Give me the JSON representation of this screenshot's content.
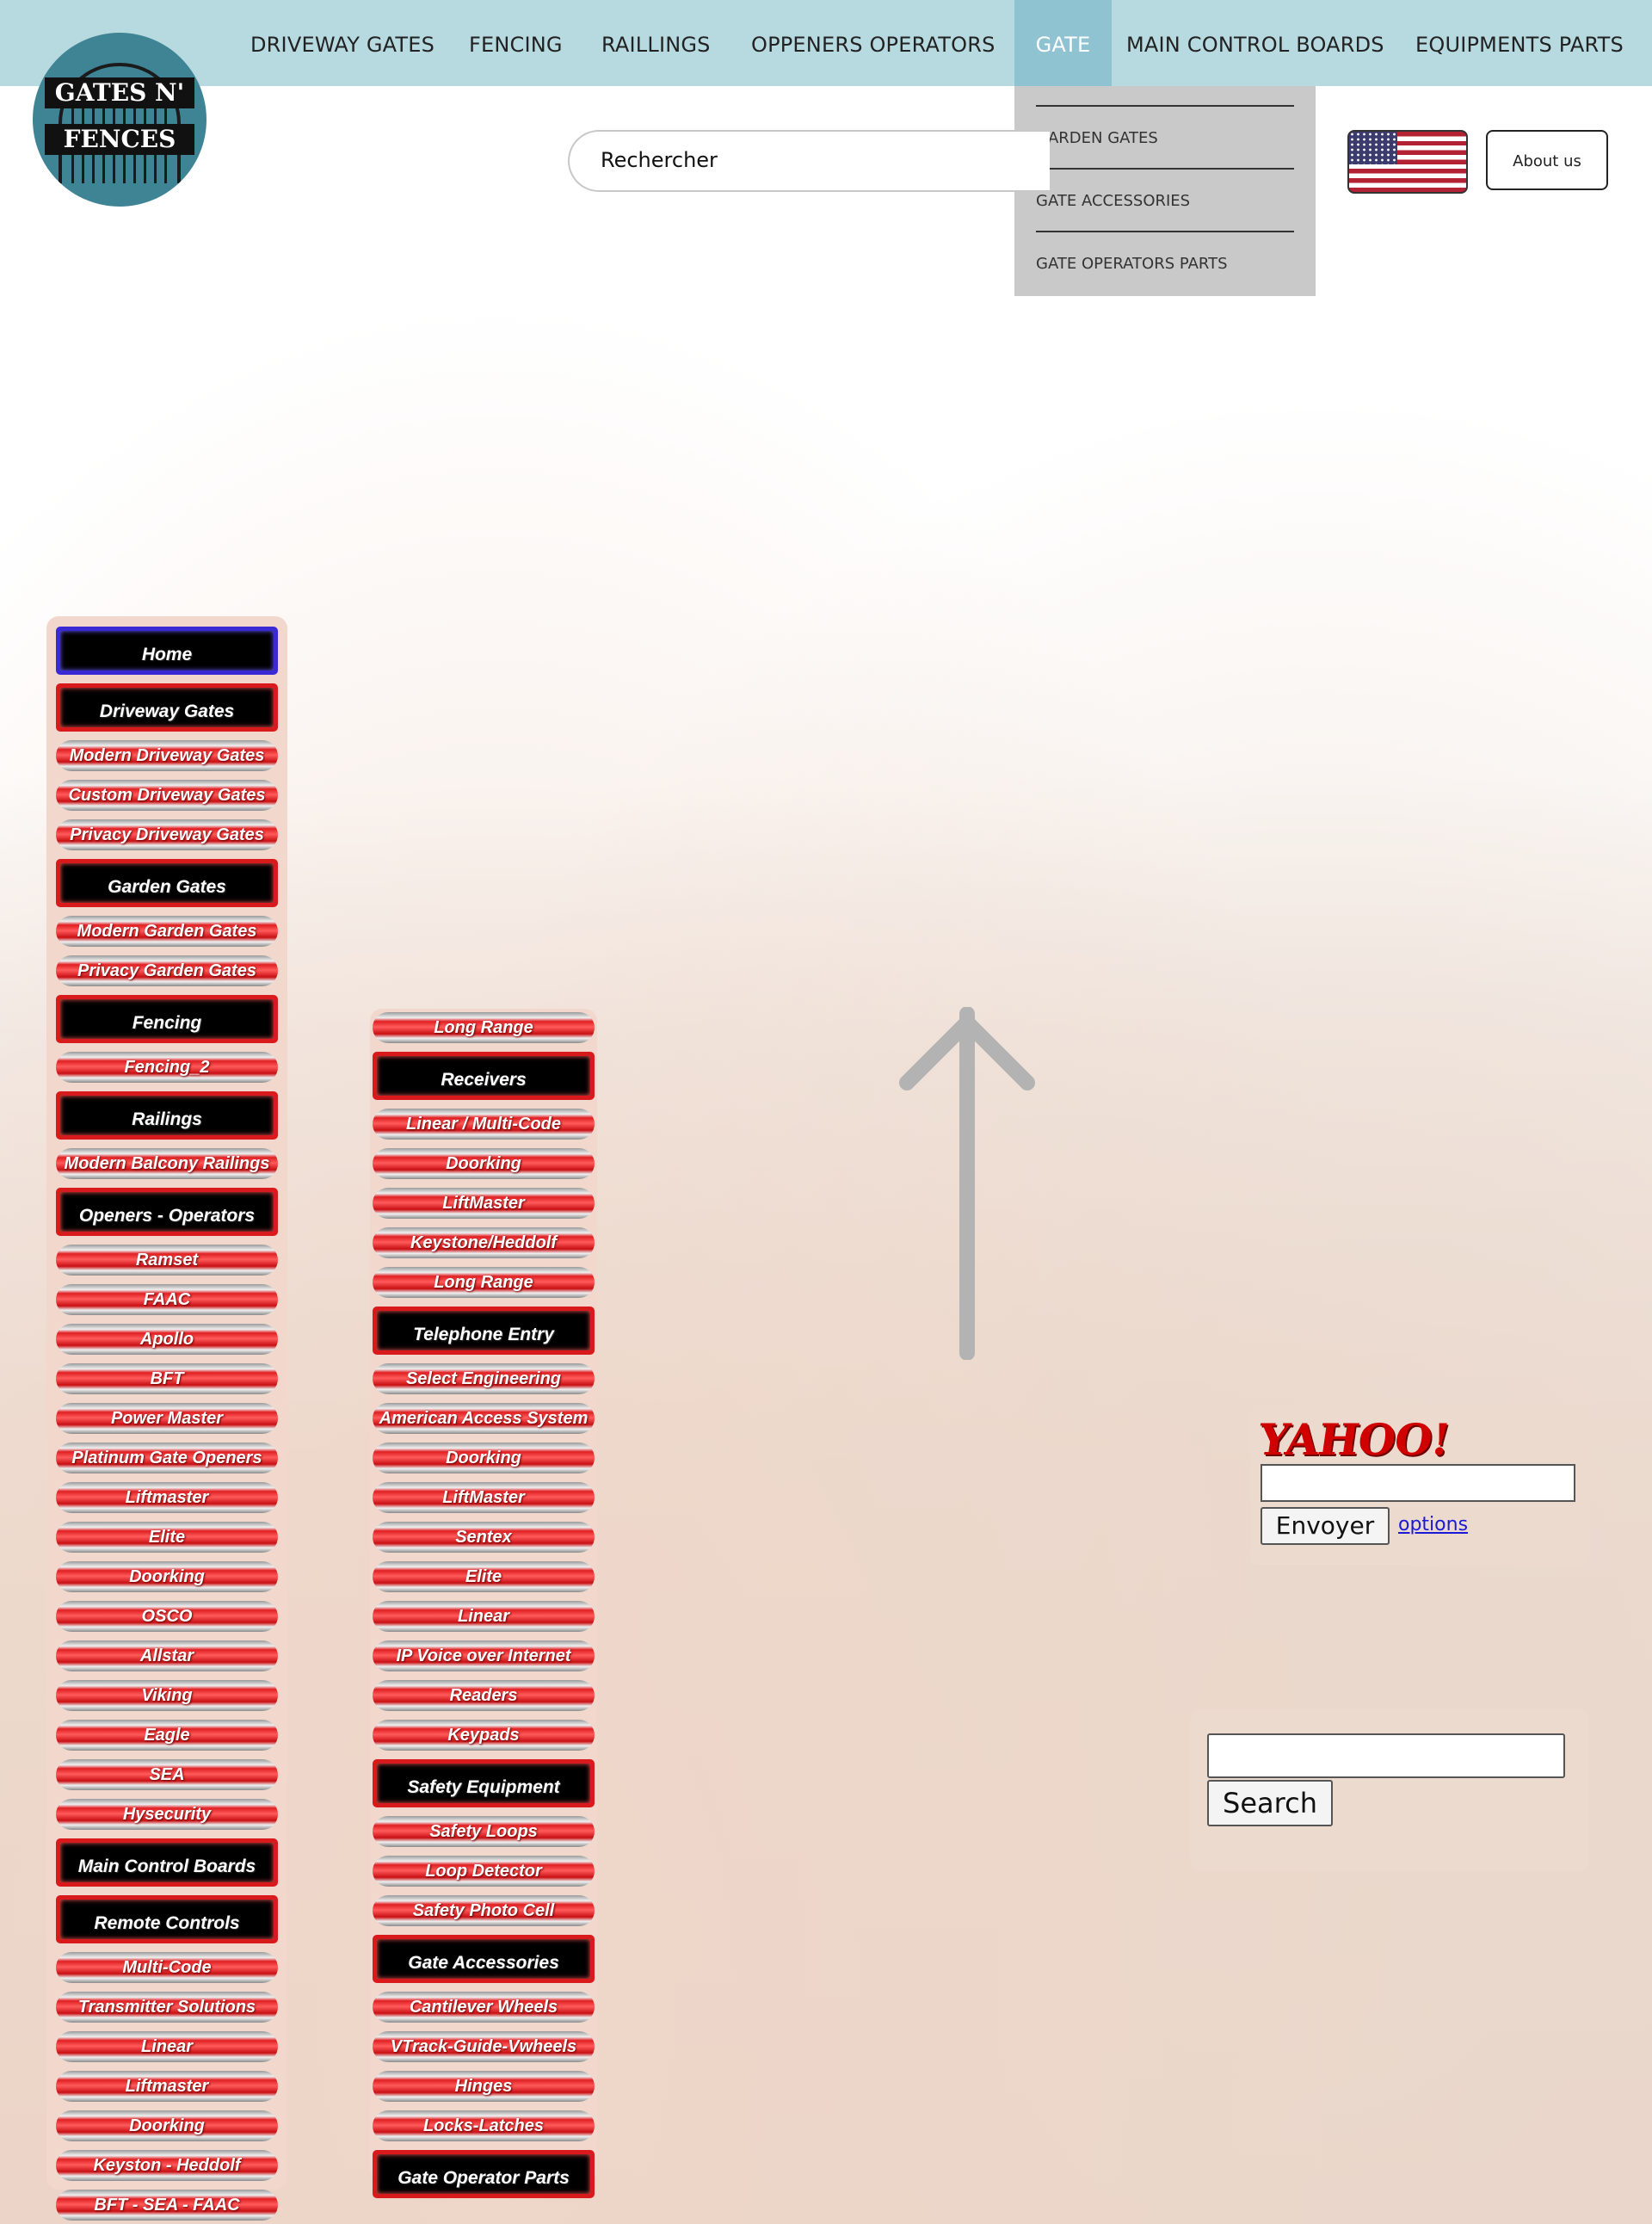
{
  "nav": {
    "items": [
      "DRIVEWAY GATES",
      "FENCING",
      "RAILLINGS",
      "OPPENERS OPERATORS",
      "GATE",
      "MAIN CONTROL BOARDS",
      "EQUIPMENTS PARTS"
    ],
    "active": "GATE",
    "dropdown": [
      "GARDEN GATES",
      "GATE ACCESSORIES",
      "GATE OPERATORS PARTS"
    ]
  },
  "logo": {
    "line1": "GATES N'",
    "line2": "FENCES"
  },
  "search": {
    "placeholder": "Rechercher"
  },
  "header": {
    "flag_icon": "us-flag-icon",
    "about_label": "About us"
  },
  "left_menu": [
    {
      "label": "Home",
      "type": "home"
    },
    {
      "label": "Driveway Gates",
      "type": "head"
    },
    {
      "label": "Modern Driveway Gates",
      "type": "sub"
    },
    {
      "label": "Custom Driveway Gates",
      "type": "sub"
    },
    {
      "label": "Privacy Driveway Gates",
      "type": "sub"
    },
    {
      "label": "Garden Gates",
      "type": "head"
    },
    {
      "label": "Modern Garden Gates",
      "type": "sub"
    },
    {
      "label": "Privacy Garden Gates",
      "type": "sub"
    },
    {
      "label": "Fencing",
      "type": "head"
    },
    {
      "label": "Fencing_2",
      "type": "sub"
    },
    {
      "label": "Railings",
      "type": "head"
    },
    {
      "label": "Modern Balcony Railings",
      "type": "sub"
    },
    {
      "label": "Openers - Operators",
      "type": "head"
    },
    {
      "label": "Ramset",
      "type": "sub"
    },
    {
      "label": "FAAC",
      "type": "sub"
    },
    {
      "label": "Apollo",
      "type": "sub"
    },
    {
      "label": "BFT",
      "type": "sub"
    },
    {
      "label": "Power Master",
      "type": "sub"
    },
    {
      "label": "Platinum Gate Openers",
      "type": "sub"
    },
    {
      "label": "Liftmaster",
      "type": "sub"
    },
    {
      "label": "Elite",
      "type": "sub"
    },
    {
      "label": "Doorking",
      "type": "sub"
    },
    {
      "label": "OSCO",
      "type": "sub"
    },
    {
      "label": "Allstar",
      "type": "sub"
    },
    {
      "label": "Viking",
      "type": "sub"
    },
    {
      "label": "Eagle",
      "type": "sub"
    },
    {
      "label": "SEA",
      "type": "sub"
    },
    {
      "label": "Hysecurity",
      "type": "sub"
    },
    {
      "label": "Main Control Boards",
      "type": "head"
    },
    {
      "label": "Remote Controls",
      "type": "head"
    },
    {
      "label": "Multi-Code",
      "type": "sub"
    },
    {
      "label": "Transmitter Solutions",
      "type": "sub"
    },
    {
      "label": "Linear",
      "type": "sub"
    },
    {
      "label": "Liftmaster",
      "type": "sub"
    },
    {
      "label": "Doorking",
      "type": "sub"
    },
    {
      "label": "Keyston - Heddolf",
      "type": "sub"
    },
    {
      "label": "BFT - SEA - FAAC",
      "type": "sub"
    }
  ],
  "right_menu": [
    {
      "label": "Long Range",
      "type": "sub"
    },
    {
      "label": "Receivers",
      "type": "head"
    },
    {
      "label": "Linear / Multi-Code",
      "type": "sub"
    },
    {
      "label": "Doorking",
      "type": "sub"
    },
    {
      "label": "LiftMaster",
      "type": "sub"
    },
    {
      "label": "Keystone/Heddolf",
      "type": "sub"
    },
    {
      "label": "Long Range",
      "type": "sub"
    },
    {
      "label": "Telephone Entry",
      "type": "head"
    },
    {
      "label": "Select Engineering",
      "type": "sub"
    },
    {
      "label": "American Access System",
      "type": "sub"
    },
    {
      "label": "Doorking",
      "type": "sub"
    },
    {
      "label": "LiftMaster",
      "type": "sub"
    },
    {
      "label": "Sentex",
      "type": "sub"
    },
    {
      "label": "Elite",
      "type": "sub"
    },
    {
      "label": "Linear",
      "type": "sub"
    },
    {
      "label": "IP Voice over Internet",
      "type": "sub"
    },
    {
      "label": "Readers",
      "type": "sub"
    },
    {
      "label": "Keypads",
      "type": "sub"
    },
    {
      "label": "Safety Equipment",
      "type": "head"
    },
    {
      "label": "Safety Loops",
      "type": "sub"
    },
    {
      "label": "Loop Detector",
      "type": "sub"
    },
    {
      "label": "Safety Photo Cell",
      "type": "sub"
    },
    {
      "label": "Gate Accessories",
      "type": "head"
    },
    {
      "label": "Cantilever Wheels",
      "type": "sub"
    },
    {
      "label": "VTrack-Guide-Vwheels",
      "type": "sub"
    },
    {
      "label": "Hinges",
      "type": "sub"
    },
    {
      "label": "Locks-Latches",
      "type": "sub"
    },
    {
      "label": "Gate Operator Parts",
      "type": "head"
    }
  ],
  "scroll_top": {
    "icon": "arrow-up-icon"
  },
  "yahoo": {
    "logo": "YAHOO!",
    "button": "Envoyer",
    "options_link": "options"
  },
  "site_search": {
    "button": "Search"
  }
}
